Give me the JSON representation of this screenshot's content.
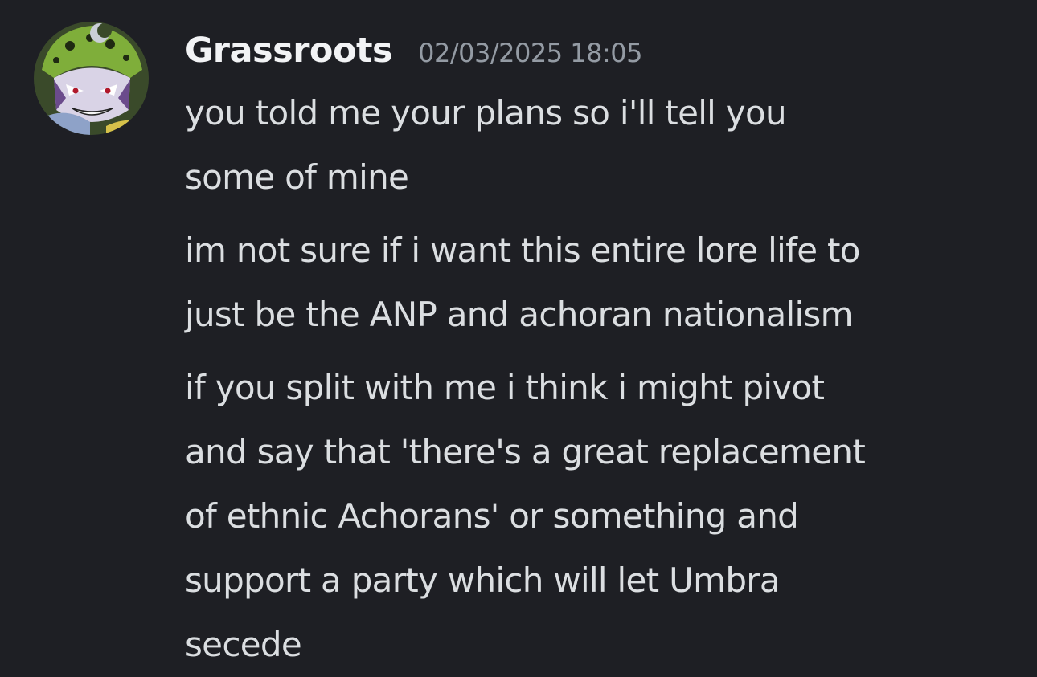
{
  "author": {
    "name": "Grassroots",
    "timestamp": "02/03/2025 18:05"
  },
  "messages": [
    {
      "lines": [
        "you told me your plans so i'll tell you",
        "some of mine"
      ]
    },
    {
      "lines": [
        "im not sure if i want this entire lore life to",
        "just be the ANP and achoran nationalism"
      ]
    },
    {
      "lines": [
        "if you split with me i think i might pivot",
        "and say that 'there's a great replacement",
        "of ethnic Achorans' or something and",
        "support a party which will let Umbra",
        "secede"
      ]
    }
  ],
  "colors": {
    "background": "#1e1f24",
    "username": "#f2f3f5",
    "timestamp": "#949ba4",
    "message_text": "#dbdee1"
  },
  "icons": {
    "avatar": "cartoon-character-avatar-icon"
  }
}
